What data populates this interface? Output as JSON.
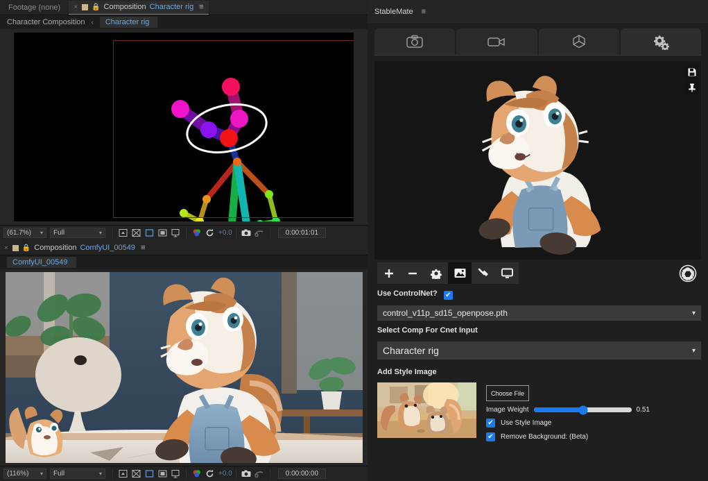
{
  "ae": {
    "top_panel": {
      "inactive_tab": "Footage (none)",
      "close_glyph": "×",
      "composition_word": "Composition",
      "composition_name": "Character rig",
      "menu_glyph": "≡",
      "breadcrumb_parent": "Character Composition",
      "breadcrumb_arrow": "‹",
      "breadcrumb_current": "Character rig",
      "toolbar": {
        "zoom": "(61.7%)",
        "resolution": "Full",
        "exposure": "+0.0",
        "timecode": "0:00:01:01"
      }
    },
    "bottom_panel": {
      "close_glyph": "×",
      "composition_word": "Composition",
      "composition_name": "ComfyUI_00549",
      "menu_glyph": "≡",
      "breadcrumb_current": "ComfyUI_00549",
      "toolbar": {
        "zoom": "(116%)",
        "resolution": "Full",
        "exposure": "+0.0",
        "timecode": "0:00:00:00"
      }
    },
    "toolbar_icons": [
      "take-snapshot-icon",
      "show-channel-icon",
      "toggle-transparency-grid-icon",
      "region-of-interest-icon",
      "toggle-mask-icon",
      "channel-rgb-icon",
      "exposure-reset-icon",
      "camera-snapshot-icon",
      "show-snapshot-icon"
    ]
  },
  "stablemate": {
    "title": "StableMate",
    "menu_glyph": "≡",
    "tabs": [
      {
        "name": "tab-image",
        "icon": "camera-icon",
        "active": false
      },
      {
        "name": "tab-video",
        "icon": "video-camera-icon",
        "active": false
      },
      {
        "name": "tab-3d",
        "icon": "cube-icon",
        "active": false
      },
      {
        "name": "tab-settings",
        "icon": "gears-icon",
        "active": true
      }
    ],
    "preview": {
      "save_icon": "save-icon",
      "pin_icon": "pin-icon"
    },
    "icon_toolbar": [
      {
        "name": "add-button",
        "icon": "plus-icon",
        "selected": false
      },
      {
        "name": "remove-button",
        "icon": "minus-icon",
        "selected": false
      },
      {
        "name": "settings-button",
        "icon": "gear-icon",
        "selected": false
      },
      {
        "name": "image-button",
        "icon": "image-icon",
        "selected": true
      },
      {
        "name": "tools-button",
        "icon": "hammer-icon",
        "selected": false
      },
      {
        "name": "display-button",
        "icon": "monitor-icon",
        "selected": false
      }
    ],
    "aperture_icon": "aperture-icon",
    "controlnet": {
      "use_label": "Use ControlNet?",
      "use_checked": true,
      "check_glyph": "✔",
      "model": "control_v11p_sd15_openpose.pth",
      "comp_label": "Select Comp For Cnet Input",
      "comp_value": "Character rig",
      "caret_glyph": "⌄"
    },
    "style": {
      "heading": "Add Style Image",
      "choose_file": "Choose File",
      "weight_label": "Image Weight",
      "weight_value": "0.51",
      "weight_percent": 51,
      "use_style_label": "Use Style Image",
      "use_style_checked": true,
      "remove_bg_label": "Remove Background: (Beta)",
      "remove_bg_checked": true,
      "check_glyph": "✔"
    },
    "accent_color": "#1a7af0"
  }
}
